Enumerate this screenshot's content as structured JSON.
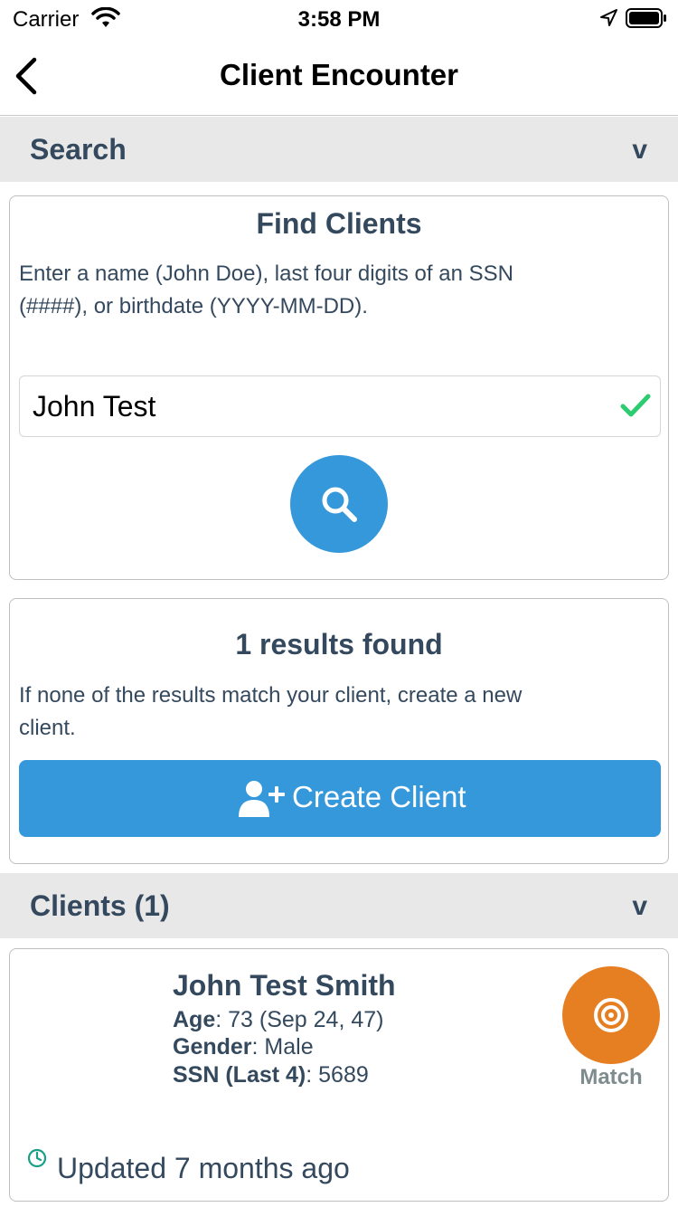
{
  "status_bar": {
    "carrier": "Carrier",
    "time": "3:58 PM"
  },
  "nav": {
    "title": "Client Encounter",
    "back_icon": "chevron-left-icon"
  },
  "search_section": {
    "header": "Search",
    "chevron": "v",
    "card": {
      "title": "Find Clients",
      "description": "Enter a name (John Doe), last four digits of an SSN (####), or birthdate (YYYY-MM-DD).",
      "input_value": "John Test",
      "search_icon": "search-icon"
    }
  },
  "results": {
    "title": "1 results found",
    "description": "If none of the results match your client, create a new client.",
    "create_button_label": "Create Client",
    "create_icon": "user-plus-icon"
  },
  "clients_section": {
    "header": "Clients (1)",
    "chevron": "v",
    "client": {
      "name": "John Test Smith",
      "age_label": "Age",
      "age_value": ": 73 (Sep 24, 47)",
      "gender_label": "Gender",
      "gender_value": ": Male",
      "ssn_label": "SSN (Last 4)",
      "ssn_value": ": 5689",
      "match_label": "Match",
      "updated": "Updated 7 months ago"
    }
  },
  "colors": {
    "primary": "#3498db",
    "match": "#e67e22",
    "text": "#34495e",
    "success": "#2ecc71",
    "updated_icon": "#16a085",
    "section_bg": "#e8e8e8"
  }
}
